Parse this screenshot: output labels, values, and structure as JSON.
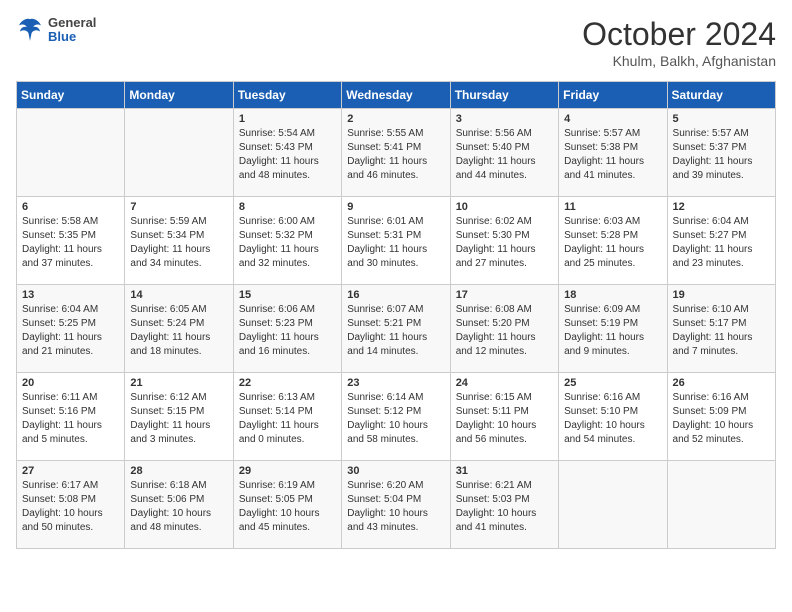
{
  "header": {
    "logo": {
      "general": "General",
      "blue": "Blue"
    },
    "title": "October 2024",
    "location": "Khulm, Balkh, Afghanistan"
  },
  "weekdays": [
    "Sunday",
    "Monday",
    "Tuesday",
    "Wednesday",
    "Thursday",
    "Friday",
    "Saturday"
  ],
  "weeks": [
    [
      {
        "day": "",
        "content": ""
      },
      {
        "day": "",
        "content": ""
      },
      {
        "day": "1",
        "content": "Sunrise: 5:54 AM\nSunset: 5:43 PM\nDaylight: 11 hours and 48 minutes."
      },
      {
        "day": "2",
        "content": "Sunrise: 5:55 AM\nSunset: 5:41 PM\nDaylight: 11 hours and 46 minutes."
      },
      {
        "day": "3",
        "content": "Sunrise: 5:56 AM\nSunset: 5:40 PM\nDaylight: 11 hours and 44 minutes."
      },
      {
        "day": "4",
        "content": "Sunrise: 5:57 AM\nSunset: 5:38 PM\nDaylight: 11 hours and 41 minutes."
      },
      {
        "day": "5",
        "content": "Sunrise: 5:57 AM\nSunset: 5:37 PM\nDaylight: 11 hours and 39 minutes."
      }
    ],
    [
      {
        "day": "6",
        "content": "Sunrise: 5:58 AM\nSunset: 5:35 PM\nDaylight: 11 hours and 37 minutes."
      },
      {
        "day": "7",
        "content": "Sunrise: 5:59 AM\nSunset: 5:34 PM\nDaylight: 11 hours and 34 minutes."
      },
      {
        "day": "8",
        "content": "Sunrise: 6:00 AM\nSunset: 5:32 PM\nDaylight: 11 hours and 32 minutes."
      },
      {
        "day": "9",
        "content": "Sunrise: 6:01 AM\nSunset: 5:31 PM\nDaylight: 11 hours and 30 minutes."
      },
      {
        "day": "10",
        "content": "Sunrise: 6:02 AM\nSunset: 5:30 PM\nDaylight: 11 hours and 27 minutes."
      },
      {
        "day": "11",
        "content": "Sunrise: 6:03 AM\nSunset: 5:28 PM\nDaylight: 11 hours and 25 minutes."
      },
      {
        "day": "12",
        "content": "Sunrise: 6:04 AM\nSunset: 5:27 PM\nDaylight: 11 hours and 23 minutes."
      }
    ],
    [
      {
        "day": "13",
        "content": "Sunrise: 6:04 AM\nSunset: 5:25 PM\nDaylight: 11 hours and 21 minutes."
      },
      {
        "day": "14",
        "content": "Sunrise: 6:05 AM\nSunset: 5:24 PM\nDaylight: 11 hours and 18 minutes."
      },
      {
        "day": "15",
        "content": "Sunrise: 6:06 AM\nSunset: 5:23 PM\nDaylight: 11 hours and 16 minutes."
      },
      {
        "day": "16",
        "content": "Sunrise: 6:07 AM\nSunset: 5:21 PM\nDaylight: 11 hours and 14 minutes."
      },
      {
        "day": "17",
        "content": "Sunrise: 6:08 AM\nSunset: 5:20 PM\nDaylight: 11 hours and 12 minutes."
      },
      {
        "day": "18",
        "content": "Sunrise: 6:09 AM\nSunset: 5:19 PM\nDaylight: 11 hours and 9 minutes."
      },
      {
        "day": "19",
        "content": "Sunrise: 6:10 AM\nSunset: 5:17 PM\nDaylight: 11 hours and 7 minutes."
      }
    ],
    [
      {
        "day": "20",
        "content": "Sunrise: 6:11 AM\nSunset: 5:16 PM\nDaylight: 11 hours and 5 minutes."
      },
      {
        "day": "21",
        "content": "Sunrise: 6:12 AM\nSunset: 5:15 PM\nDaylight: 11 hours and 3 minutes."
      },
      {
        "day": "22",
        "content": "Sunrise: 6:13 AM\nSunset: 5:14 PM\nDaylight: 11 hours and 0 minutes."
      },
      {
        "day": "23",
        "content": "Sunrise: 6:14 AM\nSunset: 5:12 PM\nDaylight: 10 hours and 58 minutes."
      },
      {
        "day": "24",
        "content": "Sunrise: 6:15 AM\nSunset: 5:11 PM\nDaylight: 10 hours and 56 minutes."
      },
      {
        "day": "25",
        "content": "Sunrise: 6:16 AM\nSunset: 5:10 PM\nDaylight: 10 hours and 54 minutes."
      },
      {
        "day": "26",
        "content": "Sunrise: 6:16 AM\nSunset: 5:09 PM\nDaylight: 10 hours and 52 minutes."
      }
    ],
    [
      {
        "day": "27",
        "content": "Sunrise: 6:17 AM\nSunset: 5:08 PM\nDaylight: 10 hours and 50 minutes."
      },
      {
        "day": "28",
        "content": "Sunrise: 6:18 AM\nSunset: 5:06 PM\nDaylight: 10 hours and 48 minutes."
      },
      {
        "day": "29",
        "content": "Sunrise: 6:19 AM\nSunset: 5:05 PM\nDaylight: 10 hours and 45 minutes."
      },
      {
        "day": "30",
        "content": "Sunrise: 6:20 AM\nSunset: 5:04 PM\nDaylight: 10 hours and 43 minutes."
      },
      {
        "day": "31",
        "content": "Sunrise: 6:21 AM\nSunset: 5:03 PM\nDaylight: 10 hours and 41 minutes."
      },
      {
        "day": "",
        "content": ""
      },
      {
        "day": "",
        "content": ""
      }
    ]
  ]
}
